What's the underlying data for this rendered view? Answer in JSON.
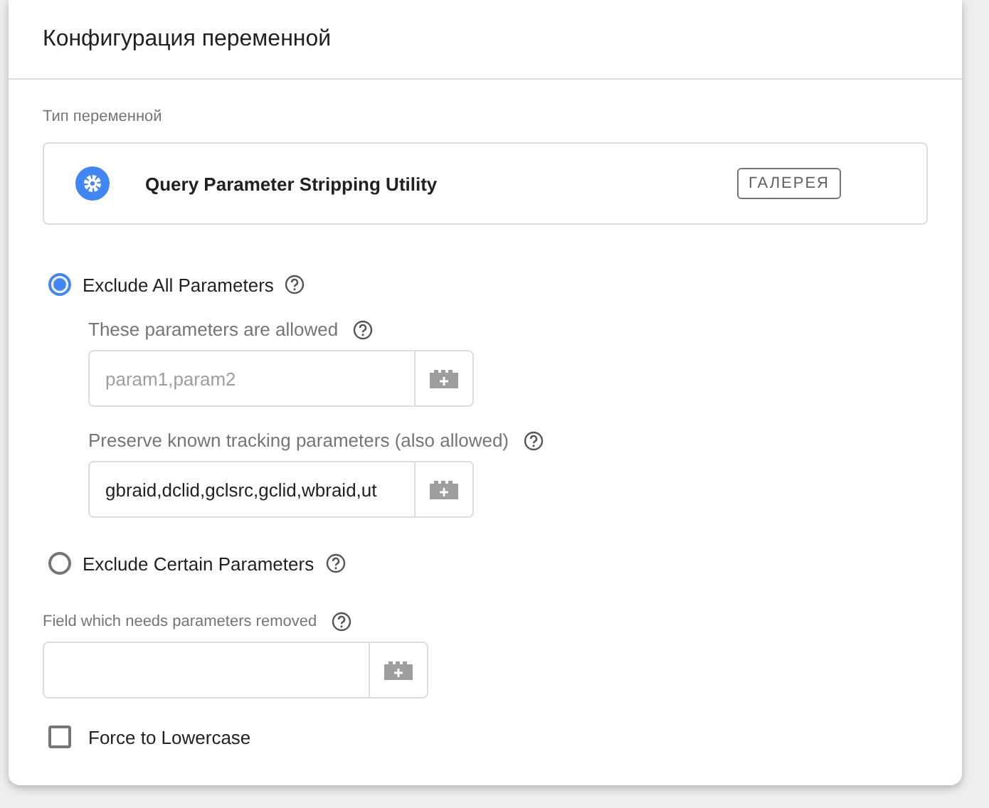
{
  "title": "Конфигурация переменной",
  "variable_type": {
    "label": "Тип переменной",
    "name": "Query Parameter Stripping Utility",
    "button": "ГАЛЕРЕЯ"
  },
  "options": [
    {
      "label": "Exclude All Parameters",
      "selected": true,
      "fields": [
        {
          "label": "These parameters are allowed",
          "placeholder": "param1,param2"
        },
        {
          "label": "Preserve known tracking parameters (also allowed)",
          "value": "gbraid,dclid,gclsrc,gclid,wbraid,ut"
        }
      ]
    },
    {
      "label": "Exclude Certain Parameters",
      "selected": false
    }
  ],
  "field": {
    "label": "Field which needs parameters removed"
  },
  "checkbox": {
    "label": "Force to Lowercase",
    "checked": false
  }
}
